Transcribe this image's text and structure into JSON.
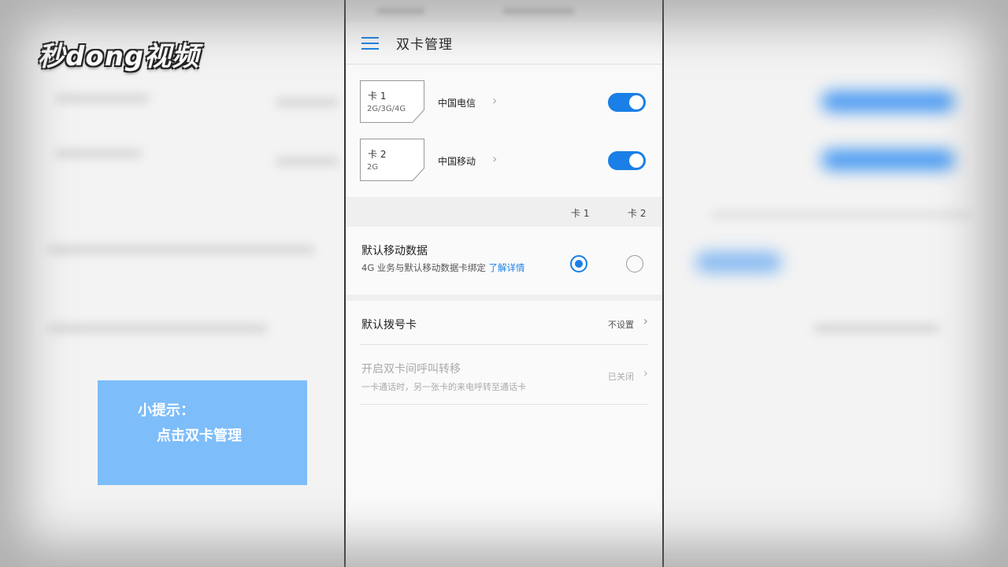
{
  "logo": {
    "text": "秒dong视频"
  },
  "tip": {
    "line1": "小提示：",
    "line2": "点击双卡管理"
  },
  "appbar": {
    "title": "双卡管理"
  },
  "sims": [
    {
      "name": "卡 1",
      "networks": "2G/3G/4G",
      "carrier": "中国电信",
      "enabled": true
    },
    {
      "name": "卡 2",
      "networks": "2G",
      "carrier": "中国移动",
      "enabled": true
    }
  ],
  "columns": {
    "card1": "卡 1",
    "card2": "卡 2"
  },
  "default_data": {
    "title": "默认移动数据",
    "desc": "4G 业务与默认移动数据卡绑定 ",
    "link": "了解详情",
    "selected": "card1"
  },
  "default_dial": {
    "title": "默认拨号卡",
    "value": "不设置"
  },
  "call_forward": {
    "title": "开启双卡间呼叫转移",
    "desc": "一卡通话时，另一张卡的来电呼转至通话卡",
    "value": "已关闭"
  },
  "colors": {
    "accent": "#1a7fe6",
    "tip_bg": "#7dbdfa"
  }
}
